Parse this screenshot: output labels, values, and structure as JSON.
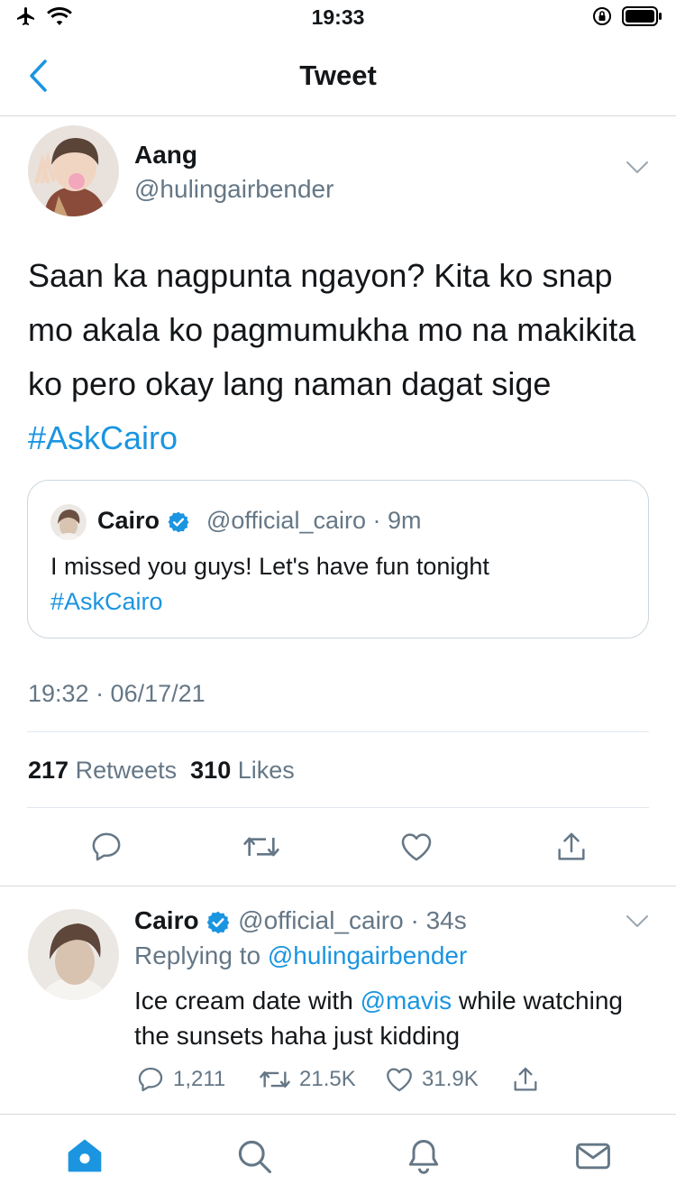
{
  "status_bar": {
    "time": "19:33"
  },
  "nav": {
    "title": "Tweet"
  },
  "main_tweet": {
    "name": "Aang",
    "handle": "@hulingairbender",
    "text": "Saan ka nagpunta ngayon? Kita ko snap mo akala ko pagmumukha mo na makikita ko pero okay lang naman dagat sige",
    "hashtag": "#AskCairo",
    "quote": {
      "name": "Cairo",
      "handle_time": "@official_cairo · 9m",
      "text": "I missed you guys! Let's have fun tonight",
      "hashtag": "#AskCairo"
    },
    "timestamp": "19:32 · 06/17/21",
    "retweet_count": "217",
    "retweet_label": "Retweets",
    "like_count": "310",
    "like_label": "Likes"
  },
  "reply": {
    "name": "Cairo",
    "handle_time": "@official_cairo · 34s",
    "replying_prefix": "Replying to",
    "replying_to": "@hulingairbender",
    "text_before": "Ice cream date with",
    "mention": "@mavis",
    "text_after": "while watching the sunsets haha just kidding",
    "replies": "1,211",
    "retweets": "21.5K",
    "likes": "31.9K"
  },
  "colors": {
    "accent": "#1b95e0",
    "secondary_text": "#657786",
    "primary_text": "#14171a",
    "divider": "#e1e8ed"
  },
  "icons": [
    "airplane-icon",
    "wifi-icon",
    "rotation-lock-icon",
    "battery-icon",
    "back-chevron-icon",
    "chevron-down-icon",
    "verified-badge-icon",
    "reply-icon",
    "retweet-icon",
    "like-icon",
    "share-icon",
    "home-icon",
    "search-icon",
    "notifications-icon",
    "messages-icon"
  ]
}
